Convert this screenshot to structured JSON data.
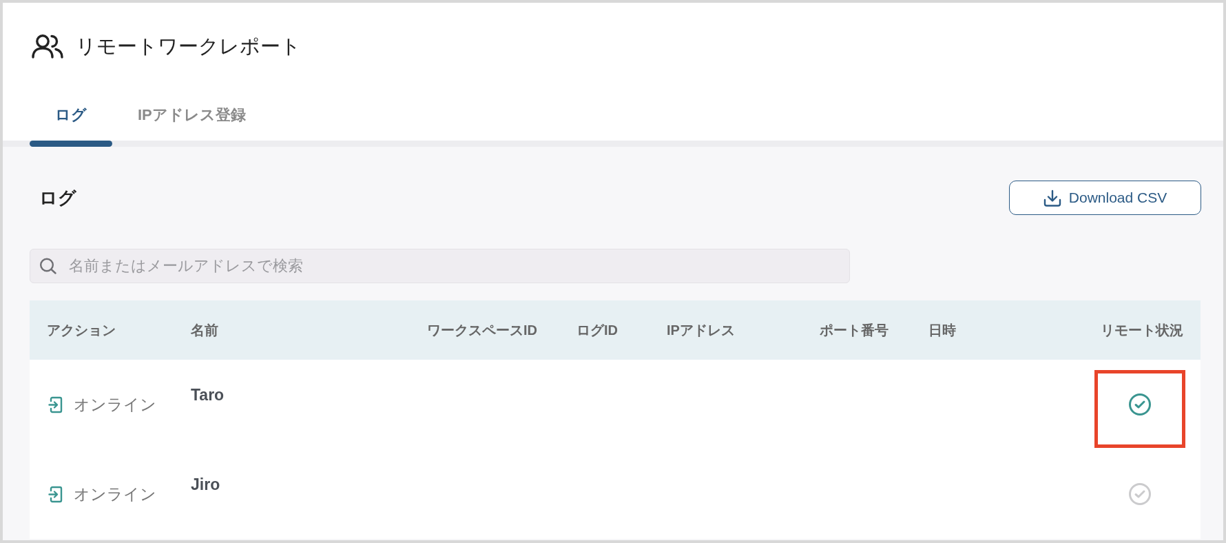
{
  "header": {
    "title": "リモートワークレポート"
  },
  "tabs": [
    {
      "label": "ログ",
      "selected": true
    },
    {
      "label": "IPアドレス登録",
      "selected": false
    }
  ],
  "section": {
    "title": "ログ",
    "download_button": "Download CSV"
  },
  "search": {
    "placeholder": "名前またはメールアドレスで検索"
  },
  "table": {
    "columns": [
      "アクション",
      "名前",
      "ワークスペースID",
      "ログID",
      "IPアドレス",
      "ポート番号",
      "日時",
      "リモート状況"
    ],
    "rows": [
      {
        "action": "オンライン",
        "name": "Taro",
        "remote": true,
        "highlighted": true
      },
      {
        "action": "オンライン",
        "name": "Jiro",
        "remote": false,
        "highlighted": false
      }
    ]
  }
}
